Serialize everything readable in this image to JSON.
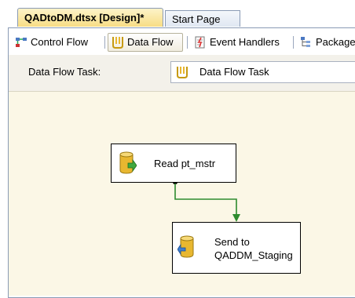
{
  "doc_tabs": [
    {
      "label": "QADtoDM.dtsx [Design]*",
      "active": true
    },
    {
      "label": "Start Page",
      "active": false
    }
  ],
  "designer_tabs": [
    {
      "label": "Control Flow",
      "icon": "control-flow-icon"
    },
    {
      "label": "Data Flow",
      "icon": "data-flow-icon",
      "selected": true
    },
    {
      "label": "Event Handlers",
      "icon": "event-handlers-icon"
    },
    {
      "label": "Package I",
      "icon": "package-explorer-icon"
    }
  ],
  "task": {
    "label": "Data Flow Task:",
    "value": "Data Flow Task"
  },
  "components": {
    "source": {
      "label": "Read pt_mstr",
      "icon": "source-cylinder-icon"
    },
    "destination": {
      "label_line1": "Send to",
      "label_line2": "QADDM_Staging",
      "icon": "destination-cylinder-icon"
    }
  },
  "colors": {
    "canvas": "#fbf7e6",
    "connector": "#2e8b2e",
    "cylinder": "#e8b730"
  }
}
